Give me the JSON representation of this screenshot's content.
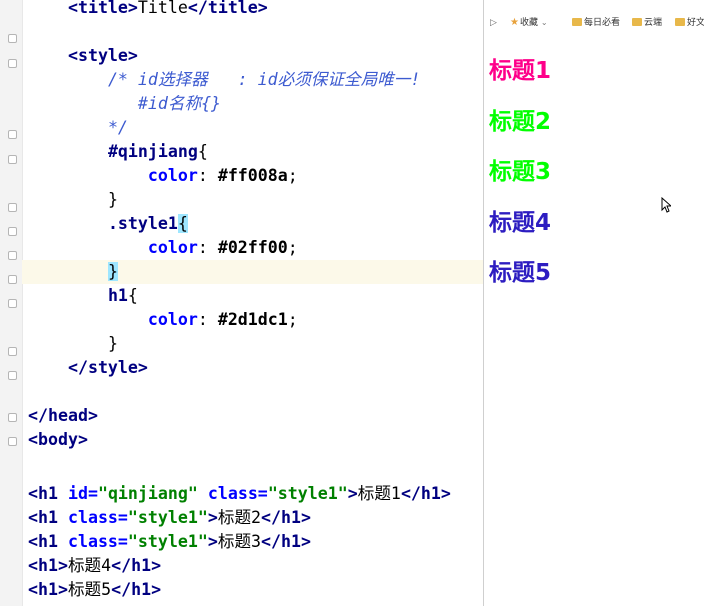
{
  "editor": {
    "lines": [
      {
        "segs": [
          {
            "t": "    ",
            "c": ""
          },
          {
            "t": "<title>",
            "c": "tag"
          },
          {
            "t": "Title",
            "c": ""
          },
          {
            "t": "</title>",
            "c": "tag"
          }
        ]
      },
      {
        "segs": []
      },
      {
        "segs": [
          {
            "t": "    ",
            "c": ""
          },
          {
            "t": "<style>",
            "c": "tag"
          }
        ]
      },
      {
        "segs": [
          {
            "t": "        ",
            "c": ""
          },
          {
            "t": "/* id选择器   : id必须保证全局唯一!",
            "c": "cmt"
          }
        ]
      },
      {
        "segs": [
          {
            "t": "           ",
            "c": ""
          },
          {
            "t": "#id名称{}",
            "c": "cmt"
          }
        ]
      },
      {
        "segs": [
          {
            "t": "        ",
            "c": ""
          },
          {
            "t": "*/",
            "c": "cmt"
          }
        ]
      },
      {
        "segs": [
          {
            "t": "        ",
            "c": ""
          },
          {
            "t": "#qinjiang",
            "c": "sel"
          },
          {
            "t": "{",
            "c": ""
          }
        ]
      },
      {
        "segs": [
          {
            "t": "            ",
            "c": ""
          },
          {
            "t": "color",
            "c": "prop"
          },
          {
            "t": ": ",
            "c": ""
          },
          {
            "t": "#ff008a",
            "c": "val"
          },
          {
            "t": ";",
            "c": ""
          }
        ]
      },
      {
        "segs": [
          {
            "t": "        ",
            "c": ""
          },
          {
            "t": "}",
            "c": ""
          }
        ]
      },
      {
        "segs": [
          {
            "t": "        ",
            "c": ""
          },
          {
            "t": ".style1",
            "c": "sel"
          },
          {
            "t": "{",
            "c": "brace-match"
          }
        ]
      },
      {
        "segs": [
          {
            "t": "            ",
            "c": ""
          },
          {
            "t": "color",
            "c": "prop"
          },
          {
            "t": ": ",
            "c": ""
          },
          {
            "t": "#02ff00",
            "c": "val"
          },
          {
            "t": ";",
            "c": ""
          }
        ]
      },
      {
        "segs": [
          {
            "t": "        ",
            "c": ""
          },
          {
            "t": "}",
            "c": "brace-match"
          }
        ]
      },
      {
        "segs": [
          {
            "t": "        ",
            "c": ""
          },
          {
            "t": "h1",
            "c": "sel"
          },
          {
            "t": "{",
            "c": ""
          }
        ]
      },
      {
        "segs": [
          {
            "t": "            ",
            "c": ""
          },
          {
            "t": "color",
            "c": "prop"
          },
          {
            "t": ": ",
            "c": ""
          },
          {
            "t": "#2d1dc1",
            "c": "val"
          },
          {
            "t": ";",
            "c": ""
          }
        ]
      },
      {
        "segs": [
          {
            "t": "        ",
            "c": ""
          },
          {
            "t": "}",
            "c": ""
          }
        ]
      },
      {
        "segs": [
          {
            "t": "    ",
            "c": ""
          },
          {
            "t": "</style>",
            "c": "tag"
          }
        ]
      },
      {
        "segs": []
      },
      {
        "segs": [
          {
            "t": "</head>",
            "c": "tag"
          }
        ]
      },
      {
        "segs": [
          {
            "t": "<body>",
            "c": "tag"
          }
        ]
      },
      {
        "segs": []
      },
      {
        "segs": [
          {
            "t": "<h1 ",
            "c": "tag"
          },
          {
            "t": "id=",
            "c": "attr"
          },
          {
            "t": "\"qinjiang\"",
            "c": "str"
          },
          {
            "t": " ",
            "c": ""
          },
          {
            "t": "class=",
            "c": "attr"
          },
          {
            "t": "\"style1\"",
            "c": "str"
          },
          {
            "t": ">",
            "c": "tag"
          },
          {
            "t": "标题1",
            "c": ""
          },
          {
            "t": "</h1>",
            "c": "tag"
          }
        ]
      },
      {
        "segs": [
          {
            "t": "<h1 ",
            "c": "tag"
          },
          {
            "t": "class=",
            "c": "attr"
          },
          {
            "t": "\"style1\"",
            "c": "str"
          },
          {
            "t": ">",
            "c": "tag"
          },
          {
            "t": "标题2",
            "c": ""
          },
          {
            "t": "</h1>",
            "c": "tag"
          }
        ]
      },
      {
        "segs": [
          {
            "t": "<h1 ",
            "c": "tag"
          },
          {
            "t": "class=",
            "c": "attr"
          },
          {
            "t": "\"style1\"",
            "c": "str"
          },
          {
            "t": ">",
            "c": "tag"
          },
          {
            "t": "标题3",
            "c": ""
          },
          {
            "t": "</h1>",
            "c": "tag"
          }
        ]
      },
      {
        "segs": [
          {
            "t": "<h1>",
            "c": "tag"
          },
          {
            "t": "标题4",
            "c": ""
          },
          {
            "t": "</h1>",
            "c": "tag"
          }
        ]
      },
      {
        "segs": [
          {
            "t": "<h1>",
            "c": "tag"
          },
          {
            "t": "标题5",
            "c": ""
          },
          {
            "t": "</h1>",
            "c": "tag"
          }
        ]
      }
    ]
  },
  "browser": {
    "bookmarks": [
      {
        "icon": "star-icon",
        "label": "收藏",
        "chevron": "⌄"
      },
      {
        "icon": "folder-icon",
        "label": "每日必看"
      },
      {
        "icon": "folder-icon",
        "label": "云端"
      },
      {
        "icon": "folder-icon",
        "label": "好文"
      }
    ],
    "headings": [
      {
        "text": "标题1",
        "color": "#ff008a"
      },
      {
        "text": "标题2",
        "color": "#02ff00"
      },
      {
        "text": "标题3",
        "color": "#02ff00"
      },
      {
        "text": "标题4",
        "color": "#2d1dc1"
      },
      {
        "text": "标题5",
        "color": "#2d1dc1"
      }
    ]
  }
}
